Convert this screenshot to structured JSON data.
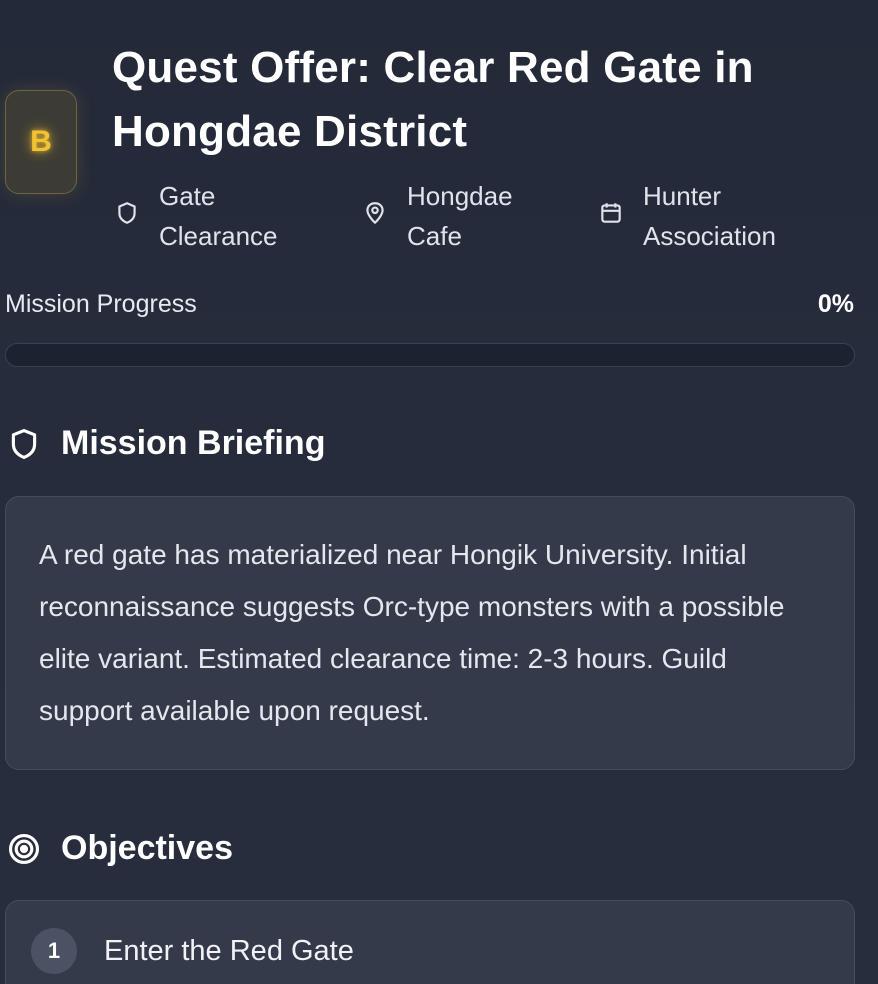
{
  "quest": {
    "rank": "B",
    "title": "Quest Offer: Clear Red Gate in Hongdae District",
    "meta": {
      "type": "Gate Clearance",
      "location": "Hongdae Cafe",
      "issuer": "Hunter Association"
    }
  },
  "progress": {
    "label": "Mission Progress",
    "value_text": "0%",
    "value": 0
  },
  "briefing": {
    "heading": "Mission Briefing",
    "text": "A red gate has materialized near Hongik University. Initial reconnaissance suggests Orc-type monsters with a possible elite variant. Estimated clearance time: 2-3 hours. Guild support available upon request."
  },
  "objectives": {
    "heading": "Objectives",
    "items": [
      {
        "number": "1",
        "text": "Enter the Red Gate"
      }
    ]
  },
  "colors": {
    "background": "#242a38",
    "rank_accent": "#f1c232",
    "card": "#343a4a"
  },
  "icons": {
    "type": "shield-icon",
    "location": "map-pin-icon",
    "issuer": "calendar-icon",
    "briefing": "shield-icon",
    "objectives": "target-icon"
  }
}
